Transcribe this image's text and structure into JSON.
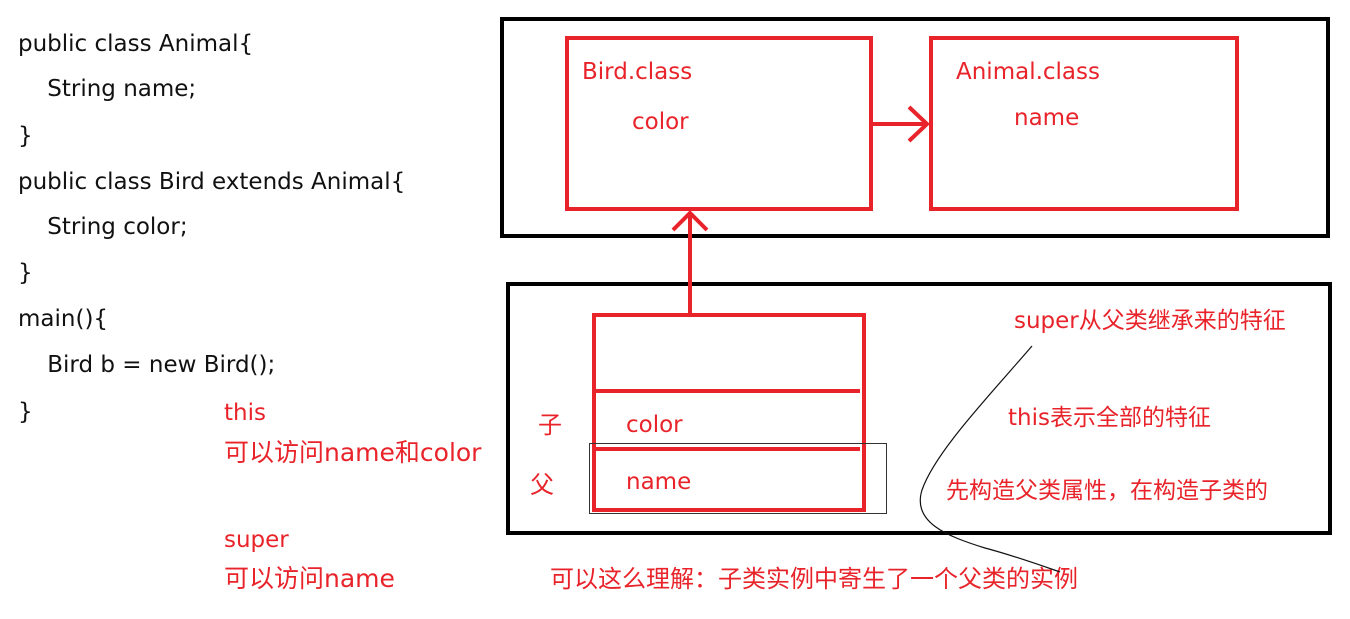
{
  "code": {
    "lines": [
      "public class Animal{",
      "    String name;",
      "}",
      "public class Bird extends Animal{",
      "    String color;",
      "}",
      "main(){",
      "    Bird b = new Bird();",
      "}"
    ]
  },
  "notes": {
    "this_keyword": "this",
    "this_access": "可以访问name和color",
    "super_keyword": "super",
    "super_access": "可以访问name"
  },
  "method_area": {
    "bird_class": {
      "title": "Bird.class",
      "field": "color"
    },
    "animal_class": {
      "title": "Animal.class",
      "field": "name"
    }
  },
  "heap": {
    "child_label": "子",
    "parent_label": "父",
    "child_field": "color",
    "parent_field": "name",
    "super_note": "super从父类继承来的特征",
    "this_note": "this表示全部的特征",
    "construct_note": "先构造父类属性，在构造子类的"
  },
  "caption": "可以这么理解：子类实例中寄生了一个父类的实例",
  "colors": {
    "red": "#e8232a",
    "black": "#000000"
  }
}
